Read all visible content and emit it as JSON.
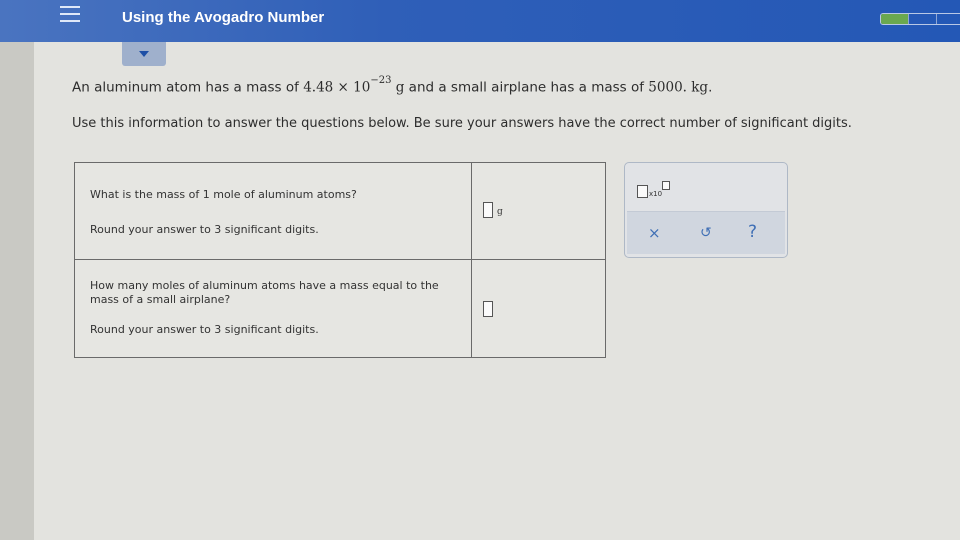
{
  "header": {
    "title": "Using the Avogadro Number",
    "progress": {
      "segments_total": 3,
      "segments_done": 1
    }
  },
  "problem": {
    "line1_before": "An aluminum atom has a mass of ",
    "mass_atom": "4.48 × 10",
    "mass_atom_exp": "−23",
    "unit_g": " g",
    "line1_middle": " and a small airplane has a mass of ",
    "mass_airplane": "5000. kg",
    "line1_end": ".",
    "line2": "Use this information to answer the questions below. Be sure your answers have the correct number of significant digits."
  },
  "questions": [
    {
      "question": "What is the mass of 1 mole of aluminum atoms?",
      "instruction": "Round your answer to 3 significant digits.",
      "answer_value": "",
      "unit": "g"
    },
    {
      "question": "How many moles of aluminum atoms have a mass equal to the mass of a small airplane?",
      "instruction": "Round your answer to 3 significant digits.",
      "answer_value": "",
      "unit": ""
    }
  ],
  "tools": {
    "sci_notation_label": "x10",
    "clear_symbol": "×",
    "undo_symbol": "↺",
    "help_symbol": "?"
  },
  "colors": {
    "header_blue": "#2458b6",
    "progress_green": "#6aa84f",
    "tool_blue": "#3f6fb5"
  },
  "icons": [
    "menu-icon",
    "chevron-down-icon",
    "sci-notation-icon",
    "clear-icon",
    "undo-icon",
    "help-icon"
  ]
}
